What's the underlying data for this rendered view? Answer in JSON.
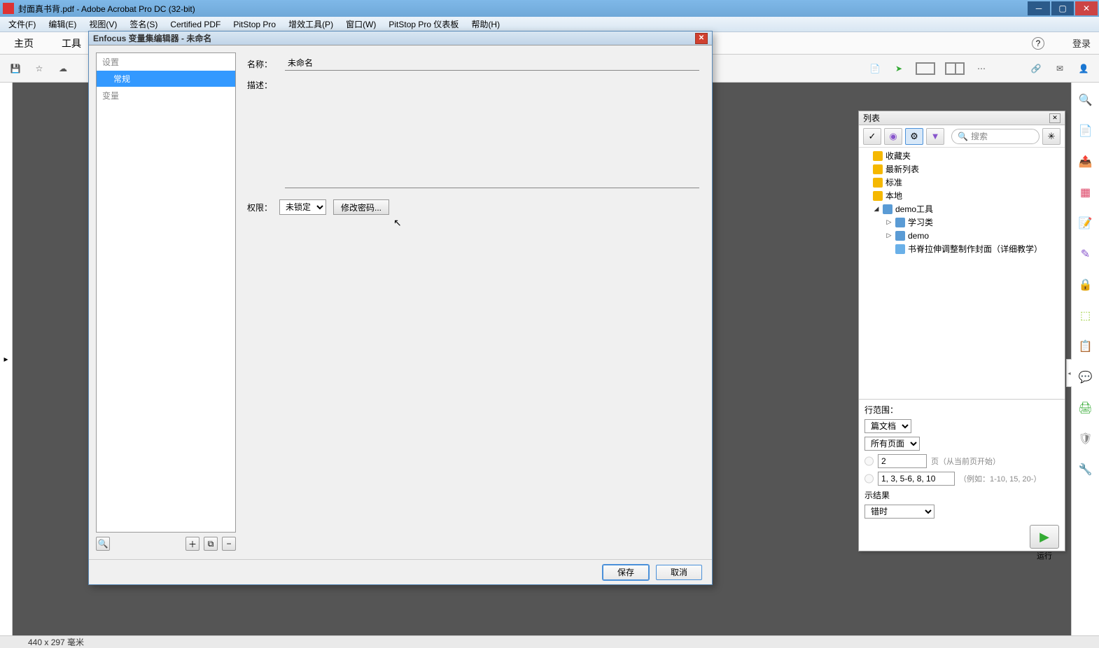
{
  "window": {
    "title": "封面真书背.pdf - Adobe Acrobat Pro DC (32-bit)"
  },
  "menubar": {
    "items": [
      "文件(F)",
      "编辑(E)",
      "视图(V)",
      "签名(S)",
      "Certified PDF",
      "PitStop Pro",
      "增效工具(P)",
      "窗口(W)",
      "PitStop Pro 仪表板",
      "帮助(H)"
    ]
  },
  "tabs": {
    "home": "主页",
    "tools": "工具",
    "login": "登录"
  },
  "dialog": {
    "title": "Enfocus 变量集编辑器 - 未命名",
    "left": {
      "settings": "设置",
      "general": "常规",
      "variables": "变量"
    },
    "form": {
      "name_label": "名称：",
      "name_value": "未命名",
      "desc_label": "描述：",
      "desc_value": "",
      "perm_label": "权限：",
      "perm_select": "未锁定",
      "change_pw": "修改密码..."
    },
    "footer": {
      "save": "保存",
      "cancel": "取消"
    }
  },
  "panel": {
    "title": "列表",
    "search_placeholder": "搜索",
    "tree": {
      "fav": "收藏夹",
      "recent": "最新列表",
      "standard": "标准",
      "local": "本地",
      "demo_tools": "demo工具",
      "study": "学习类",
      "demo": "demo",
      "spine": "书脊拉伸调整制作封面（详细教学）"
    },
    "range_label": "行范围：",
    "range_select": "篇文档",
    "pages_select": "所有页面",
    "pages_input": "2",
    "pages_hint": "页（从当前页开始）",
    "range_input": "1, 3, 5-6, 8, 10",
    "range_hint": "（例如：1-10, 15, 20-）",
    "result_label": "示结果",
    "result_select": "错时",
    "run": "运行"
  },
  "status": {
    "dims": "440 x 297 毫米"
  }
}
